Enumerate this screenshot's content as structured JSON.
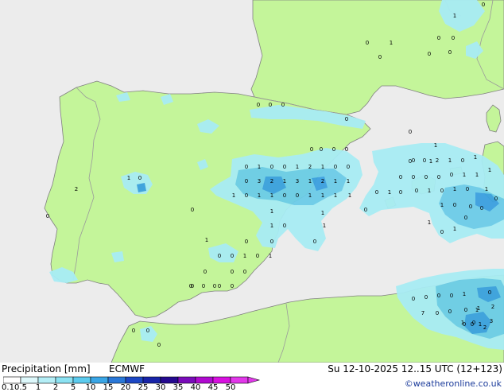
{
  "map": {
    "colors": {
      "sea": "#ececec",
      "land": "#c4f59a",
      "border": "#9a9a9a",
      "coast": "#808080",
      "precip_light": "#a8ecf4",
      "precip_mid": "#6ccce8",
      "precip_heavy": "#3aa0e0"
    },
    "values": [
      {
        "t": "0"
      },
      {
        "t": "0"
      },
      {
        "t": "0"
      },
      {
        "t": "0"
      },
      {
        "t": "1"
      },
      {
        "t": "0"
      },
      {
        "t": "0"
      },
      {
        "t": "0"
      },
      {
        "t": "1"
      },
      {
        "t": "0"
      },
      {
        "t": "0"
      },
      {
        "t": "0"
      },
      {
        "t": "0"
      },
      {
        "t": "1"
      },
      {
        "t": "0"
      },
      {
        "t": "0"
      },
      {
        "t": "0"
      },
      {
        "t": "0"
      },
      {
        "t": "0"
      },
      {
        "t": "0"
      },
      {
        "t": "1"
      },
      {
        "t": "0"
      },
      {
        "t": "1"
      },
      {
        "t": "0"
      },
      {
        "t": "0"
      },
      {
        "t": "1"
      },
      {
        "t": "2"
      },
      {
        "t": "1"
      },
      {
        "t": "0"
      },
      {
        "t": "0"
      },
      {
        "t": "0"
      },
      {
        "t": "3"
      },
      {
        "t": "2"
      },
      {
        "t": "1"
      },
      {
        "t": "3"
      },
      {
        "t": "1"
      },
      {
        "t": "2"
      },
      {
        "t": "1"
      },
      {
        "t": "1"
      },
      {
        "t": "1"
      },
      {
        "t": "0"
      },
      {
        "t": "1"
      },
      {
        "t": "1"
      },
      {
        "t": "0"
      },
      {
        "t": "0"
      },
      {
        "t": "1"
      },
      {
        "t": "1"
      },
      {
        "t": "1"
      },
      {
        "t": "1"
      },
      {
        "t": "1"
      },
      {
        "t": "0"
      },
      {
        "t": "0"
      },
      {
        "t": "0"
      },
      {
        "t": "1"
      },
      {
        "t": "0"
      },
      {
        "t": "1"
      },
      {
        "t": "0"
      },
      {
        "t": "0"
      },
      {
        "t": "0"
      },
      {
        "t": "0"
      },
      {
        "t": "0"
      },
      {
        "t": "0"
      },
      {
        "t": "1"
      },
      {
        "t": "1"
      },
      {
        "t": "0"
      },
      {
        "t": "0"
      },
      {
        "t": "2"
      },
      {
        "t": "1"
      },
      {
        "t": "0"
      },
      {
        "t": "1"
      },
      {
        "t": "1"
      },
      {
        "t": "1"
      },
      {
        "t": "0"
      },
      {
        "t": "1"
      },
      {
        "t": "0"
      },
      {
        "t": "0"
      },
      {
        "t": "0"
      },
      {
        "t": "0"
      },
      {
        "t": "1"
      },
      {
        "t": "1"
      },
      {
        "t": "0"
      },
      {
        "t": "0"
      },
      {
        "t": "1"
      },
      {
        "t": "1"
      },
      {
        "t": "1"
      },
      {
        "t": "0"
      },
      {
        "t": "1"
      },
      {
        "t": "2"
      },
      {
        "t": "0"
      },
      {
        "t": "0"
      },
      {
        "t": "0"
      },
      {
        "t": "1"
      },
      {
        "t": "0"
      },
      {
        "t": "0"
      },
      {
        "t": "0"
      },
      {
        "t": "1"
      },
      {
        "t": "0"
      },
      {
        "t": "0"
      },
      {
        "t": "1"
      },
      {
        "t": "0"
      },
      {
        "t": "1"
      },
      {
        "t": "0"
      },
      {
        "t": "0"
      },
      {
        "t": "0"
      },
      {
        "t": "0"
      },
      {
        "t": "0"
      },
      {
        "t": "0"
      },
      {
        "t": "0"
      },
      {
        "t": "0"
      },
      {
        "t": "0"
      },
      {
        "t": "0"
      },
      {
        "t": "0"
      },
      {
        "t": "0"
      },
      {
        "t": "0"
      },
      {
        "t": "0"
      },
      {
        "t": "0"
      },
      {
        "t": "0"
      },
      {
        "t": "1"
      },
      {
        "t": "0"
      },
      {
        "t": "7"
      },
      {
        "t": "0"
      },
      {
        "t": "0"
      },
      {
        "t": "0"
      },
      {
        "t": "1"
      },
      {
        "t": "2"
      },
      {
        "t": "1"
      },
      {
        "t": "0"
      },
      {
        "t": "0"
      },
      {
        "t": "1"
      },
      {
        "t": "3"
      },
      {
        "t": "0"
      },
      {
        "t": "1"
      },
      {
        "t": "2"
      },
      {
        "t": "0"
      }
    ]
  },
  "footer": {
    "title": "Precipitation [mm]",
    "model": "ECMWF",
    "datetime": "Su 12-10-2025 12..15 UTC (12+123)",
    "credit": "©weatheronline.co.uk",
    "legend": {
      "labels": [
        "0.1",
        "0.5",
        "1",
        "2",
        "5",
        "10",
        "15",
        "20",
        "25",
        "30",
        "35",
        "40",
        "45",
        "50"
      ],
      "colors": [
        "#ffffff",
        "#ddf8fb",
        "#b4eef6",
        "#8be2f2",
        "#5ccbee",
        "#3aa6e6",
        "#2a78d8",
        "#1d47c4",
        "#1824a8",
        "#250a90",
        "#7a0cba",
        "#b00ad0",
        "#d810e0",
        "#e238ea"
      ]
    }
  }
}
